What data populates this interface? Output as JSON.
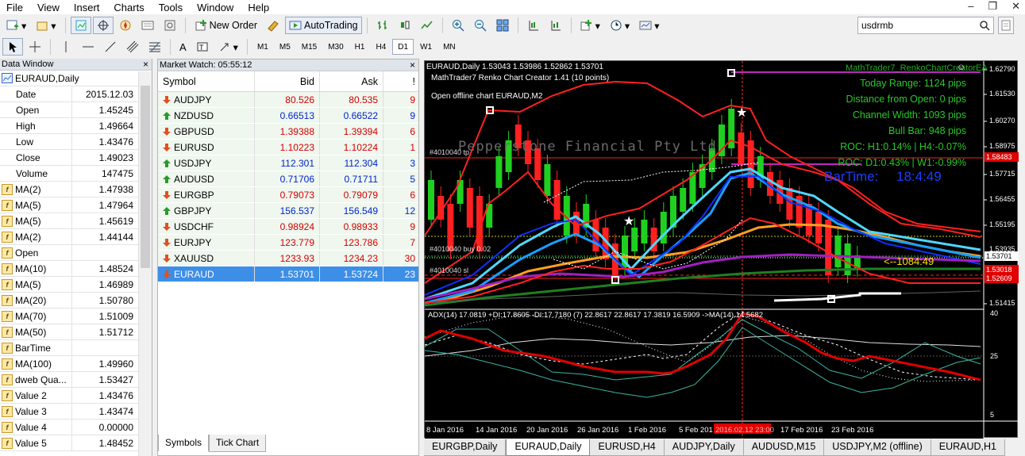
{
  "menu": [
    "File",
    "View",
    "Insert",
    "Charts",
    "Tools",
    "Window",
    "Help"
  ],
  "toolbar": {
    "new_order": "New Order",
    "auto_trading": "AutoTrading",
    "timeframes": [
      "M1",
      "M5",
      "M15",
      "M30",
      "H1",
      "H4",
      "D1",
      "W1",
      "MN"
    ],
    "active_timeframe": "D1"
  },
  "search": {
    "value": "usdrmb"
  },
  "data_window": {
    "title": "Data Window",
    "symbol": "EURAUD,Daily",
    "rows": [
      {
        "k": "Date",
        "v": "2015.12.03",
        "f": false
      },
      {
        "k": "Open",
        "v": "1.45245",
        "f": false
      },
      {
        "k": "High",
        "v": "1.49664",
        "f": false
      },
      {
        "k": "Low",
        "v": "1.43476",
        "f": false
      },
      {
        "k": "Close",
        "v": "1.49023",
        "f": false
      },
      {
        "k": "Volume",
        "v": "147475",
        "f": false
      },
      {
        "k": "MA(2)",
        "v": "1.47938",
        "f": true
      },
      {
        "k": "MA(5)",
        "v": "1.47964",
        "f": true
      },
      {
        "k": "MA(5)",
        "v": "1.45619",
        "f": true
      },
      {
        "k": "MA(2)",
        "v": "1.44144",
        "f": true
      },
      {
        "k": "Open",
        "v": "",
        "f": true
      },
      {
        "k": "MA(10)",
        "v": "1.48524",
        "f": true
      },
      {
        "k": "MA(5)",
        "v": "1.46989",
        "f": true
      },
      {
        "k": "MA(20)",
        "v": "1.50780",
        "f": true
      },
      {
        "k": "MA(70)",
        "v": "1.51009",
        "f": true
      },
      {
        "k": "MA(50)",
        "v": "1.51712",
        "f": true
      },
      {
        "k": "BarTime",
        "v": "",
        "f": true
      },
      {
        "k": "MA(100)",
        "v": "1.49960",
        "f": true
      },
      {
        "k": "dweb Qua...",
        "v": "1.53427",
        "f": true
      },
      {
        "k": "Value 2",
        "v": "1.43476",
        "f": true
      },
      {
        "k": "Value 3",
        "v": "1.43474",
        "f": true
      },
      {
        "k": "Value 4",
        "v": "0.00000",
        "f": true
      },
      {
        "k": "Value 5",
        "v": "1.48452",
        "f": true
      }
    ]
  },
  "market_watch": {
    "title": "Market Watch: 05:55:12",
    "headers": {
      "symbol": "Symbol",
      "bid": "Bid",
      "ask": "Ask",
      "spread": "!"
    },
    "rows": [
      {
        "s": "AUDJPY",
        "bid": "80.526",
        "ask": "80.535",
        "sp": "9",
        "dir": "down",
        "c": "red"
      },
      {
        "s": "NZDUSD",
        "bid": "0.66513",
        "ask": "0.66522",
        "sp": "9",
        "dir": "up",
        "c": "blue"
      },
      {
        "s": "GBPUSD",
        "bid": "1.39388",
        "ask": "1.39394",
        "sp": "6",
        "dir": "down",
        "c": "red"
      },
      {
        "s": "EURUSD",
        "bid": "1.10223",
        "ask": "1.10224",
        "sp": "1",
        "dir": "down",
        "c": "red"
      },
      {
        "s": "USDJPY",
        "bid": "112.301",
        "ask": "112.304",
        "sp": "3",
        "dir": "up",
        "c": "blue"
      },
      {
        "s": "AUDUSD",
        "bid": "0.71706",
        "ask": "0.71711",
        "sp": "5",
        "dir": "up",
        "c": "blue"
      },
      {
        "s": "EURGBP",
        "bid": "0.79073",
        "ask": "0.79079",
        "sp": "6",
        "dir": "down",
        "c": "red"
      },
      {
        "s": "GBPJPY",
        "bid": "156.537",
        "ask": "156.549",
        "sp": "12",
        "dir": "up",
        "c": "blue"
      },
      {
        "s": "USDCHF",
        "bid": "0.98924",
        "ask": "0.98933",
        "sp": "9",
        "dir": "down",
        "c": "red"
      },
      {
        "s": "EURJPY",
        "bid": "123.779",
        "ask": "123.786",
        "sp": "7",
        "dir": "down",
        "c": "red"
      },
      {
        "s": "XAUUSD",
        "bid": "1233.93",
        "ask": "1234.23",
        "sp": "30",
        "dir": "down",
        "c": "red"
      },
      {
        "s": "EURAUD",
        "bid": "1.53701",
        "ask": "1.53724",
        "sp": "23",
        "dir": "down",
        "c": "sel"
      }
    ],
    "tabs": [
      "Symbols",
      "Tick Chart"
    ]
  },
  "chart": {
    "header": "EURAUD,Daily  1.53043 1.53986 1.52862 1.53701",
    "renko_label": "MathTrader7 Renko Chart Creator 1.41 (10 points)",
    "offline_label": "Open offline chart EURAUD,M2",
    "watermark": "Pepperstone Financial Pty Ltd",
    "ea_label": "MathTrader7_RenkoChartCreatorEA",
    "info": [
      "Today Range:  1124 pips",
      "Distance from Open:  0 pips",
      "Channel Width:  1093 pips",
      "Bull Bar:  948 pips",
      "ROC: H1:0.14% | H4:-0.07%",
      "ROC: D1:0.43% | W1:-0.99%"
    ],
    "bartime_label": "BarTime:",
    "bartime_value": "18:4:49",
    "countdown": "<--1084:49",
    "line_labels": [
      "#4010040 tp",
      "#4010040 buy 0.02",
      "#4010040 sl"
    ],
    "price_axis": [
      "1.62790",
      "1.61530",
      "1.60270",
      "1.58975",
      "1.58483",
      "1.57715",
      "1.56455",
      "1.55195",
      "1.53935",
      "1.53701",
      "1.53018",
      "1.52609",
      "1.51415"
    ],
    "adx_label": "ADX(14) 17.0819 +DI:17.8605 -DI:17.7180  (7)  22.8617 22.8617 17.3819 16.5909  ->MA(14) 14.5682",
    "adx_axis": [
      "40",
      "25",
      "5"
    ],
    "dates": [
      "8 Jan 2016",
      "14 Jan 2016",
      "20 Jan 2016",
      "26 Jan 2016",
      "1 Feb 2016",
      "5 Feb 201",
      "2016.02.12 23:00",
      "17 Feb 2016",
      "23 Feb 2016"
    ]
  },
  "chart_tabs": [
    "EURGBP,Daily",
    "EURAUD,Daily",
    "EURUSD,H4",
    "AUDJPY,Daily",
    "AUDUSD,M15",
    "USDJPY,M2 (offline)",
    "EURAUD,H1"
  ],
  "active_chart_tab": "EURAUD,Daily"
}
